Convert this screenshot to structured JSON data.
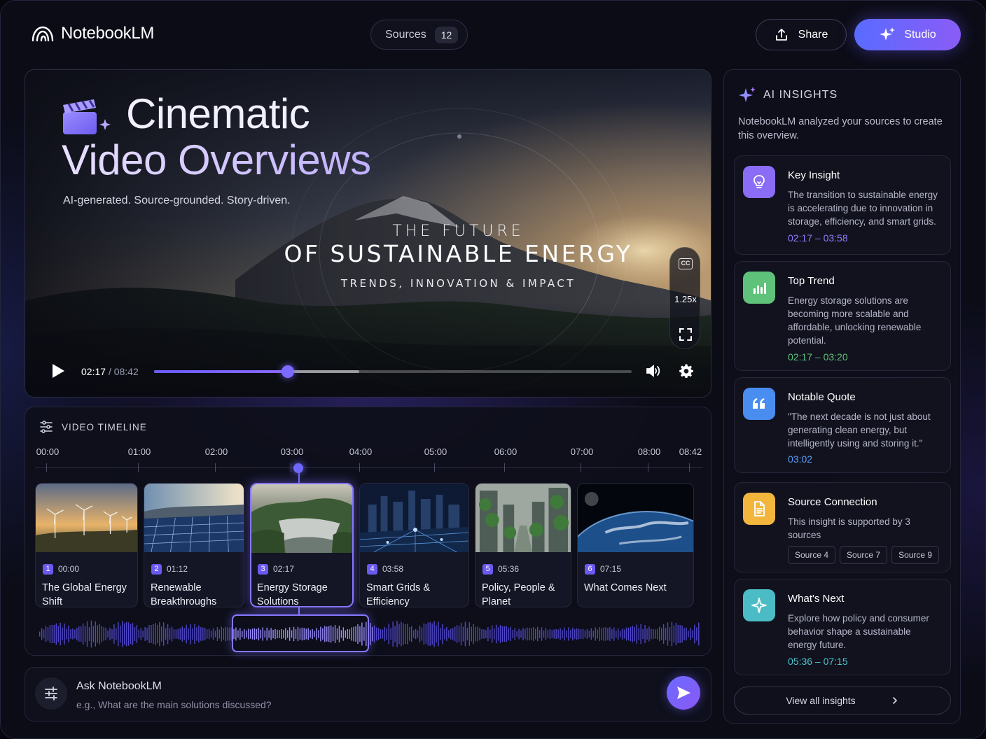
{
  "header": {
    "app_name": "NotebookLM",
    "sources_label": "Sources",
    "sources_count": "12",
    "share_label": "Share",
    "studio_label": "Studio"
  },
  "player": {
    "hero_line1": "Cinematic",
    "hero_line2": "Video Overviews",
    "hero_subtitle": "AI-generated. Source-grounded. Story-driven.",
    "film_title_1": "THE FUTURE",
    "film_title_2": "OF SUSTAINABLE ENERGY",
    "film_title_3": "TRENDS, INNOVATION & IMPACT",
    "cc_label": "CC",
    "speed": "1.25x",
    "current_time": "02:17",
    "separator": "/",
    "total_time": "08:42",
    "progress_fraction": 0.28,
    "buffered_fraction": 0.43,
    "accent": "#7b6cff"
  },
  "timeline": {
    "heading": "VIDEO TIMELINE",
    "ticks": [
      "00:00",
      "01:00",
      "02:00",
      "03:00",
      "04:00",
      "05:00",
      "06:00",
      "07:00",
      "08:00",
      "08:42"
    ],
    "chapters": [
      {
        "num": "1",
        "time": "00:00",
        "title": "The Global Energy Shift",
        "icon": "wind-turbines"
      },
      {
        "num": "2",
        "time": "01:12",
        "title": "Renewable Breakthroughs",
        "icon": "solar-panels"
      },
      {
        "num": "3",
        "time": "02:17",
        "title": "Energy Storage Solutions",
        "icon": "dam",
        "active": true
      },
      {
        "num": "4",
        "time": "03:58",
        "title": "Smart Grids & Efficiency",
        "icon": "city-grid"
      },
      {
        "num": "5",
        "time": "05:36",
        "title": "Policy, People & Planet",
        "icon": "green-city"
      },
      {
        "num": "6",
        "time": "07:15",
        "title": "What Comes Next",
        "icon": "earth"
      }
    ]
  },
  "ask": {
    "title": "Ask NotebookLM",
    "placeholder": "e.g., What are the main solutions discussed?"
  },
  "insights": {
    "heading": "AI INSIGHTS",
    "description": "NotebookLM analyzed your sources to create this overview.",
    "cards": [
      {
        "title": "Key Insight",
        "body": "The transition to sustainable energy is accelerating due to innovation in storage, efficiency, and smart grids.",
        "range": "02:17 – 03:58",
        "color": "#8a6cf6",
        "icon": "lightbulb-icon"
      },
      {
        "title": "Top Trend",
        "body": "Energy storage solutions are becoming more scalable and affordable, unlocking renewable potential.",
        "range": "02:17 – 03:20",
        "color": "#5fc27a",
        "icon": "bar-chart-icon"
      },
      {
        "title": "Notable Quote",
        "body": "\"The next decade is not just about generating clean energy, but intelligently using and storing it.\"",
        "range": "03:02",
        "color": "#4a8df0",
        "icon": "quote-icon"
      },
      {
        "title": "Source Connection",
        "body": "This insight is supported by 3 sources",
        "sources": [
          "Source 4",
          "Source 7",
          "Source 9"
        ],
        "color": "#f2b63d",
        "icon": "document-icon"
      },
      {
        "title": "What's Next",
        "body": "Explore how policy and consumer behavior shape a sustainable energy future.",
        "range": "05:36 – 07:15",
        "color": "#4bbcc6",
        "icon": "sparkle-icon"
      }
    ],
    "view_all": "View all insights"
  }
}
